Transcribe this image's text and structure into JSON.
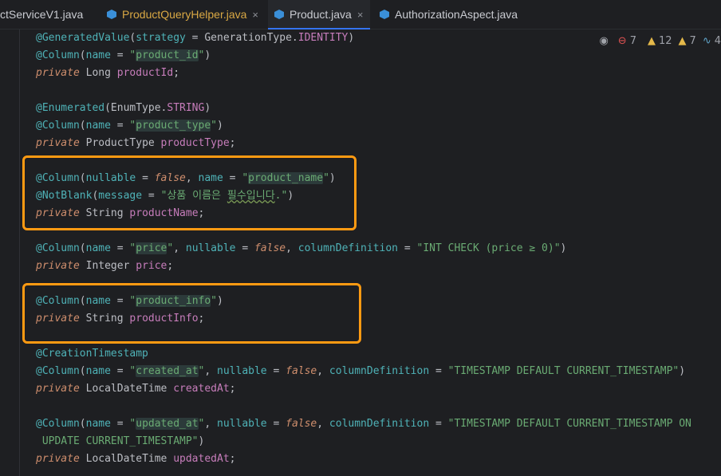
{
  "tabs": [
    {
      "label": "ctServiceV1.java",
      "active": false,
      "modified": false,
      "closable": false
    },
    {
      "label": "ProductQueryHelper.java",
      "active": false,
      "modified": true,
      "closable": true
    },
    {
      "label": "Product.java",
      "active": true,
      "modified": false,
      "closable": true
    },
    {
      "label": "AuthorizationAspect.java",
      "active": false,
      "modified": false,
      "closable": false
    }
  ],
  "tab_close_glyph": "×",
  "inspections": {
    "errors": "7",
    "warnings": "12",
    "weak_warnings": "7",
    "typos": "4"
  },
  "code": {
    "annotation_generated_value": "@GeneratedValue",
    "strategy_param": "strategy",
    "generation_type": "GenerationType",
    "identity": "IDENTITY",
    "annotation_column": "@Column",
    "name_param": "name",
    "str_product_id": "product_id",
    "kw_private": "private",
    "type_long": "Long",
    "field_product_id": "productId",
    "annotation_enumerated": "@Enumerated",
    "enum_type": "EnumType",
    "enum_string": "STRING",
    "str_product_type": "product_type",
    "type_product_type": "ProductType",
    "field_product_type": "productType",
    "nullable_param": "nullable",
    "kw_false": "false",
    "str_product_name": "product_name",
    "annotation_not_blank": "@NotBlank",
    "message_param": "message",
    "str_message_pre": "상품 이름은 ",
    "str_message_typo": "필수입니다",
    "str_message_post": ".",
    "type_string": "String",
    "field_product_name": "productName",
    "str_price": "price",
    "column_definition_param": "columnDefinition",
    "str_price_check": "INT CHECK (price ≥ 0)",
    "type_integer": "Integer",
    "field_price": "price",
    "str_product_info": "product_info",
    "field_product_info": "productInfo",
    "annotation_creation_timestamp": "@CreationTimestamp",
    "str_created_at": "created_at",
    "str_timestamp_default": "TIMESTAMP DEFAULT CURRENT_TIMESTAMP",
    "type_local_date_time": "LocalDateTime",
    "field_created_at": "createdAt",
    "str_updated_at": "updated_at",
    "str_timestamp_on": "TIMESTAMP DEFAULT CURRENT_TIMESTAMP ON",
    "str_update_current": "UPDATE CURRENT_TIMESTAMP",
    "field_updated_at": "updatedAt"
  },
  "colors": {
    "highlight_box": "#ff9a12",
    "annotation": "#4fb3b8",
    "keyword": "#cf8e6d",
    "string": "#6aab73",
    "field": "#c77dbb",
    "tab_active_underline": "#3574f0"
  }
}
